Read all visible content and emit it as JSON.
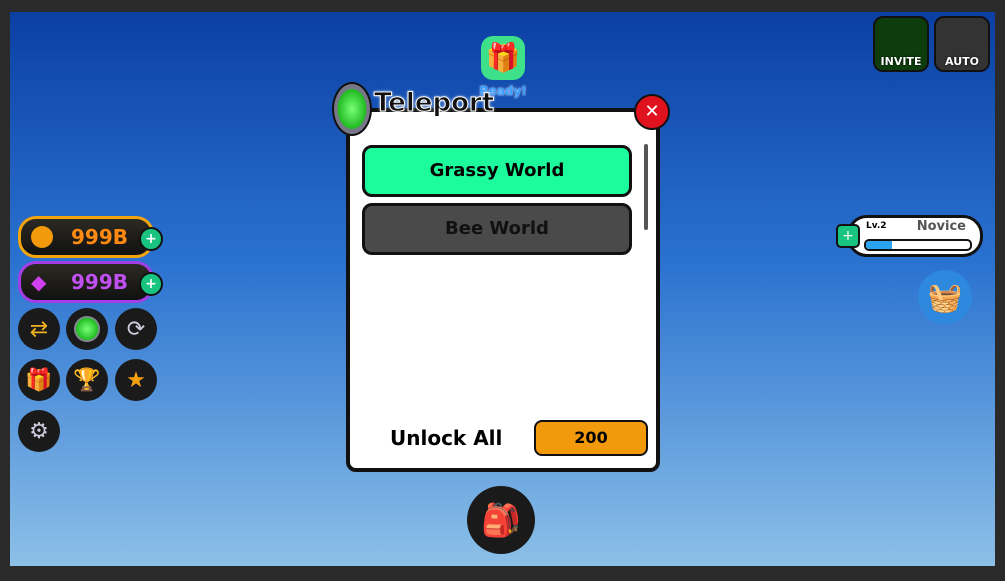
{
  "currency": {
    "coins": "999B",
    "gems": "999B"
  },
  "top_right": {
    "invite": "INVITE",
    "auto": "AUTO"
  },
  "gift": {
    "status": "Ready!"
  },
  "level": {
    "label": "Lv.2",
    "rank": "Novice",
    "progress": 0.25
  },
  "teleport": {
    "title": "Teleport",
    "worlds": [
      {
        "name": "Grassy World",
        "unlocked": true
      },
      {
        "name": "Bee World",
        "unlocked": false
      }
    ],
    "unlock_all_label": "Unlock All",
    "unlock_price": "200"
  },
  "colors": {
    "unlocked": "#1dfc9c",
    "locked": "#4a4a4a",
    "price_button": "#f39a0c",
    "close": "#e0121e"
  }
}
